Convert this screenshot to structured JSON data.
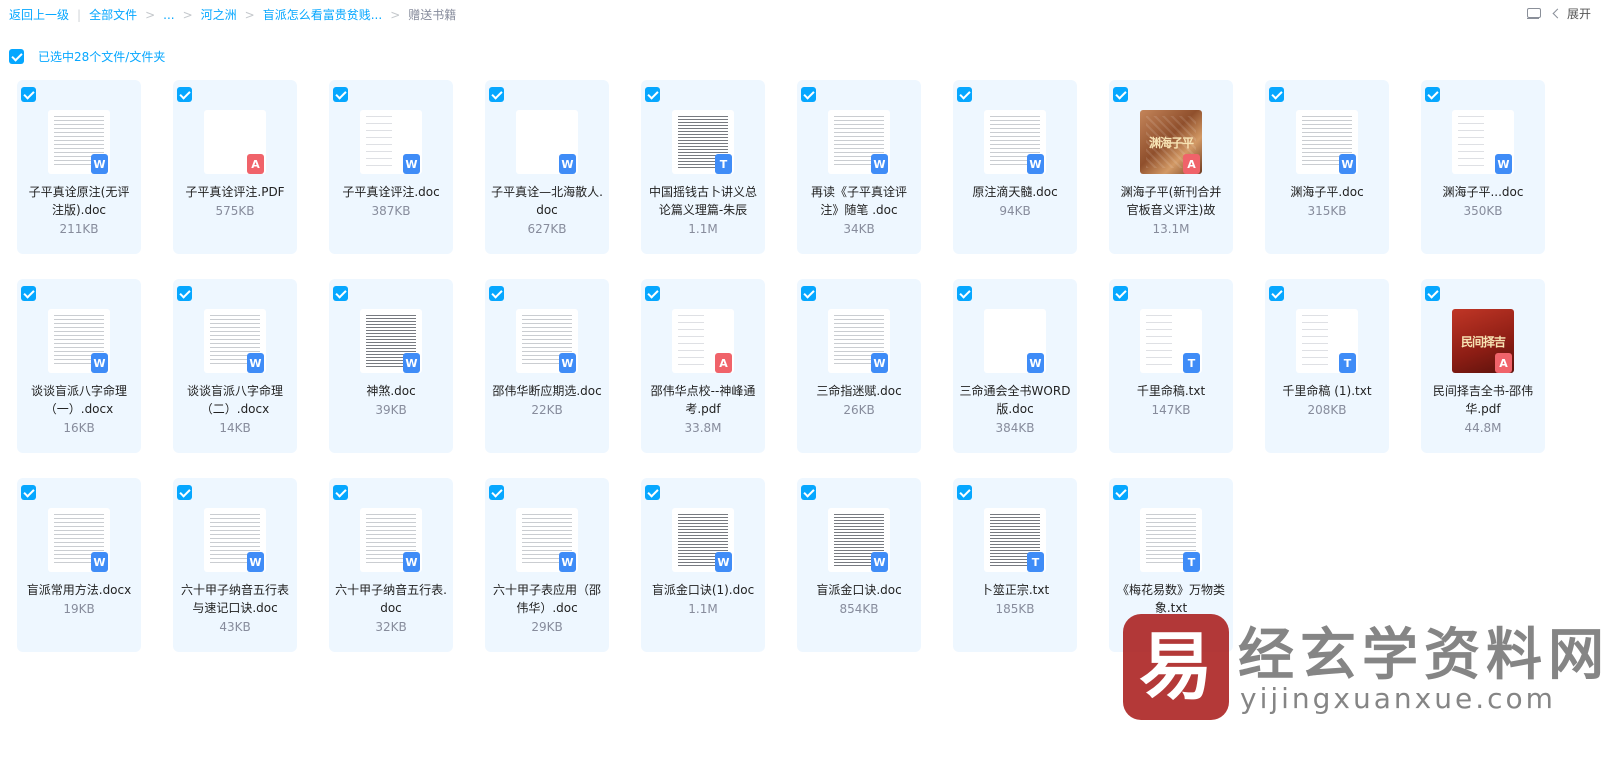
{
  "breadcrumb": {
    "back": "返回上一级",
    "root": "全部文件",
    "ellipsis": "...",
    "level1": "河之洲",
    "level2": "盲派怎么看富贵贫贱...",
    "current": "赠送书籍"
  },
  "toolbar": {
    "expand_label": "展开",
    "list_icon": "list-view-icon",
    "back_icon": "chevron-left-icon"
  },
  "selection": {
    "label": "已选中28个文件/文件夹"
  },
  "files": [
    {
      "name": "子平真诠原注(无评注版).doc",
      "size": "211KB",
      "type": "w",
      "thumb": "lines"
    },
    {
      "name": "子平真诠评注.PDF",
      "size": "575KB",
      "type": "p",
      "thumb": "blank"
    },
    {
      "name": "子平真诠评注.doc",
      "size": "387KB",
      "type": "w",
      "thumb": "sparse"
    },
    {
      "name": "子平真诠—北海散人.doc",
      "size": "627KB",
      "type": "w",
      "thumb": "blank"
    },
    {
      "name": "中国摇钱古卜讲义总论篇义理篇-朱辰",
      "size": "1.1M",
      "type": "t",
      "thumb": "dense"
    },
    {
      "name": "再读《子平真诠评注》随笔 .doc",
      "size": "34KB",
      "type": "w",
      "thumb": "lines"
    },
    {
      "name": "原注滴天髓.doc",
      "size": "94KB",
      "type": "w",
      "thumb": "lines"
    },
    {
      "name": "渊海子平(新刊合并官板音义评注)故",
      "size": "13.1M",
      "type": "p",
      "thumb": "cover1",
      "cover": "渊海子平"
    },
    {
      "name": "渊海子平.doc",
      "size": "315KB",
      "type": "w",
      "thumb": "lines"
    },
    {
      "name": "渊海子平...doc",
      "size": "350KB",
      "type": "w",
      "thumb": "sparse"
    },
    {
      "name": "谈谈盲派八字命理（一）.docx",
      "size": "16KB",
      "type": "w",
      "thumb": "lines"
    },
    {
      "name": "谈谈盲派八字命理（二）.docx",
      "size": "14KB",
      "type": "w",
      "thumb": "lines"
    },
    {
      "name": "神煞.doc",
      "size": "39KB",
      "type": "w",
      "thumb": "dense"
    },
    {
      "name": "邵伟华断应期选.doc",
      "size": "22KB",
      "type": "w",
      "thumb": "lines"
    },
    {
      "name": "邵伟华点校--神峰通考.pdf",
      "size": "33.8M",
      "type": "p",
      "thumb": "sparse"
    },
    {
      "name": "三命指迷赋.doc",
      "size": "26KB",
      "type": "w",
      "thumb": "lines"
    },
    {
      "name": "三命通会全书WORD版.doc",
      "size": "384KB",
      "type": "w",
      "thumb": "blank"
    },
    {
      "name": "千里命稿.txt",
      "size": "147KB",
      "type": "t",
      "thumb": "sparse"
    },
    {
      "name": "千里命稿 (1).txt",
      "size": "208KB",
      "type": "t",
      "thumb": "sparse"
    },
    {
      "name": "民间择吉全书-邵伟华.pdf",
      "size": "44.8M",
      "type": "p",
      "thumb": "cover2",
      "cover": "民间择吉"
    },
    {
      "name": "盲派常用方法.docx",
      "size": "19KB",
      "type": "w",
      "thumb": "lines"
    },
    {
      "name": "六十甲子纳音五行表与速记口诀.doc",
      "size": "43KB",
      "type": "w",
      "thumb": "lines"
    },
    {
      "name": "六十甲子纳音五行表.doc",
      "size": "32KB",
      "type": "w",
      "thumb": "lines"
    },
    {
      "name": "六十甲子表应用（邵伟华）.doc",
      "size": "29KB",
      "type": "w",
      "thumb": "lines"
    },
    {
      "name": "盲派金口诀(1).doc",
      "size": "1.1M",
      "type": "w",
      "thumb": "dense"
    },
    {
      "name": "盲派金口诀.doc",
      "size": "854KB",
      "type": "w",
      "thumb": "dense"
    },
    {
      "name": "卜筮正宗.txt",
      "size": "185KB",
      "type": "t",
      "thumb": "dense"
    },
    {
      "name": "《梅花易数》万物类象.txt",
      "size": "",
      "type": "t",
      "thumb": "lines"
    }
  ],
  "badge_letters": {
    "w": "W",
    "t": "T",
    "p": "A"
  },
  "watermark": {
    "logo_char": "易",
    "title": "经玄学资料网",
    "subtitle": "yijingxuanxue.com"
  },
  "colors": {
    "accent": "#06a7ff",
    "card_bg": "#eef7ff",
    "word": "#3f8cf7",
    "pdf": "#f0636a"
  }
}
